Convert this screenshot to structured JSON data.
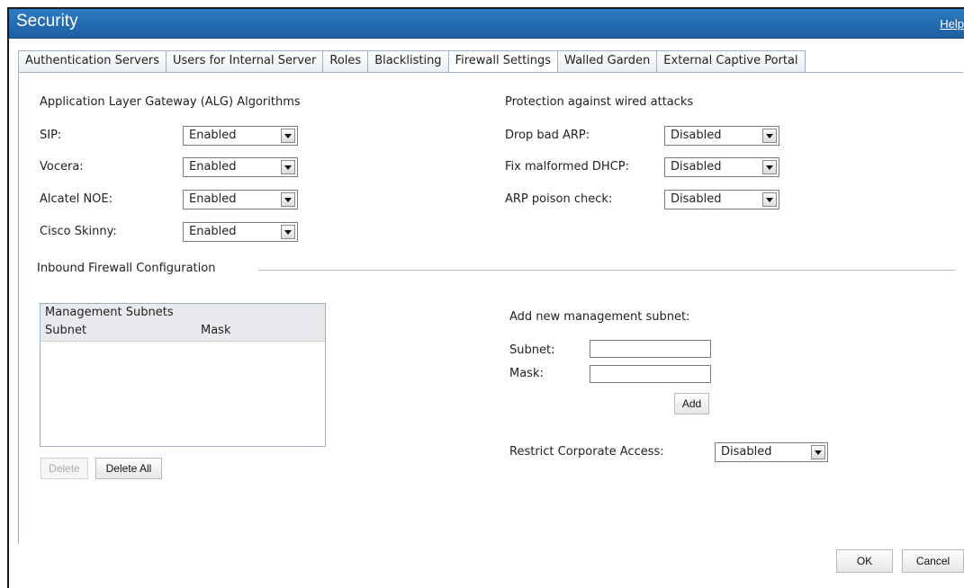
{
  "window": {
    "title": "Security",
    "help_label": "Help"
  },
  "tabs": [
    {
      "label": "Authentication Servers",
      "active": false
    },
    {
      "label": "Users for Internal Server",
      "active": false
    },
    {
      "label": "Roles",
      "active": false
    },
    {
      "label": "Blacklisting",
      "active": false
    },
    {
      "label": "Firewall Settings",
      "active": true
    },
    {
      "label": "Walled Garden",
      "active": false
    },
    {
      "label": "External Captive Portal",
      "active": false
    }
  ],
  "alg": {
    "heading": "Application Layer Gateway (ALG) Algorithms",
    "rows": [
      {
        "label": "SIP:",
        "value": "Enabled"
      },
      {
        "label": "Vocera:",
        "value": "Enabled"
      },
      {
        "label": "Alcatel NOE:",
        "value": "Enabled"
      },
      {
        "label": "Cisco Skinny:",
        "value": "Enabled"
      }
    ]
  },
  "wired": {
    "heading": "Protection against wired attacks",
    "rows": [
      {
        "label": "Drop bad ARP:",
        "value": "Disabled"
      },
      {
        "label": "Fix malformed DHCP:",
        "value": "Disabled"
      },
      {
        "label": "ARP poison check:",
        "value": "Disabled"
      }
    ]
  },
  "inbound": {
    "heading": "Inbound Firewall Configuration",
    "list_title": "Management Subnets",
    "col_subnet": "Subnet",
    "col_mask": "Mask",
    "delete_label": "Delete",
    "delete_all_label": "Delete All"
  },
  "add_subnet": {
    "heading": "Add new management subnet:",
    "subnet_label": "Subnet:",
    "mask_label": "Mask:",
    "subnet_value": "",
    "mask_value": "",
    "add_label": "Add"
  },
  "restrict": {
    "label": "Restrict Corporate Access:",
    "value": "Disabled"
  },
  "footer": {
    "ok_label": "OK",
    "cancel_label": "Cancel"
  }
}
